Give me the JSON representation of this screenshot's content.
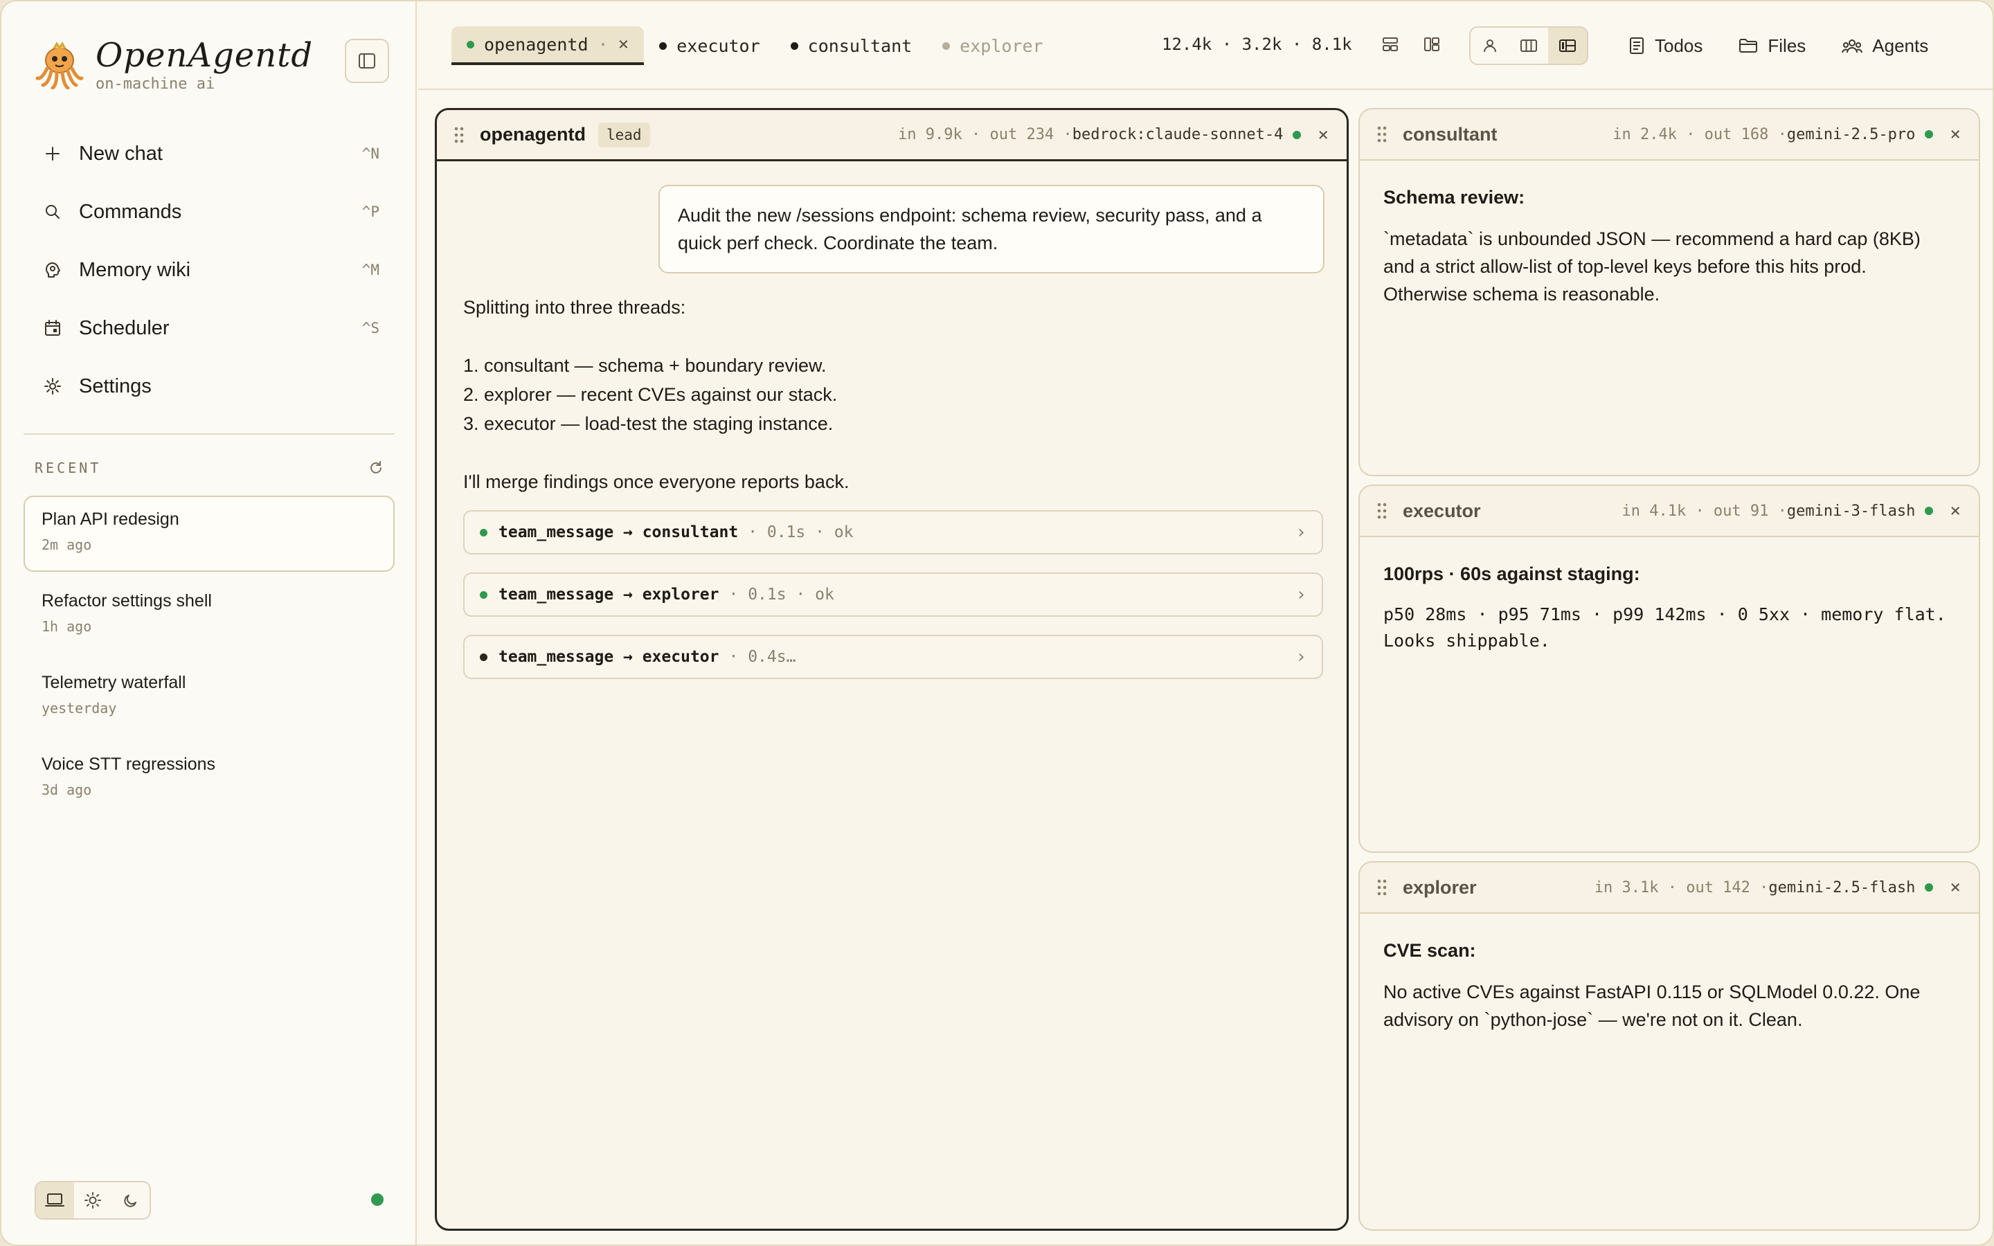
{
  "sidebar": {
    "brand": {
      "name": "OpenAgentd",
      "tagline": "on-machine ai"
    },
    "nav": [
      {
        "label": "New chat",
        "shortcut": "^N",
        "icon": "plus-icon"
      },
      {
        "label": "Commands",
        "shortcut": "^P",
        "icon": "search-icon"
      },
      {
        "label": "Memory wiki",
        "shortcut": "^M",
        "icon": "brain-icon"
      },
      {
        "label": "Scheduler",
        "shortcut": "^S",
        "icon": "calendar-icon"
      },
      {
        "label": "Settings",
        "shortcut": "",
        "icon": "gear-icon"
      }
    ],
    "recent_title": "RECENT",
    "recent": [
      {
        "name": "Plan API redesign",
        "time": "2m ago"
      },
      {
        "name": "Refactor settings shell",
        "time": "1h ago"
      },
      {
        "name": "Telemetry waterfall",
        "time": "yesterday"
      },
      {
        "name": "Voice STT regressions",
        "time": "3d ago"
      }
    ]
  },
  "topbar": {
    "tabs": [
      {
        "label": "openagentd",
        "sep": "·",
        "close": "×"
      },
      {
        "label": "executor"
      },
      {
        "label": "consultant"
      },
      {
        "label": "explorer"
      }
    ],
    "counts": "12.4k · 3.2k · 8.1k",
    "actions": [
      "Todos",
      "Files",
      "Agents"
    ]
  },
  "lead_pane": {
    "title": "openagentd",
    "badge": "lead",
    "meta": "in 9.9k · out 234 · ",
    "model": "bedrock:claude-sonnet-4",
    "close": "×",
    "user_message": "Audit the new /sessions endpoint: schema review, security pass, and a quick perf check. Coordinate the team.",
    "assistant": {
      "intro": "Splitting into three threads:",
      "steps": [
        "1. consultant — schema + boundary review.",
        "2. explorer — recent CVEs against our stack.",
        "3. executor — load-test the staging instance."
      ],
      "outro": "I'll merge findings once everyone reports back."
    },
    "tools": [
      {
        "name": "team_message → consultant",
        "meta": "· 0.1s · ok",
        "status": "ok",
        "chevron": "›"
      },
      {
        "name": "team_message → explorer",
        "meta": "· 0.1s · ok",
        "status": "ok",
        "chevron": "›"
      },
      {
        "name": "team_message → executor",
        "meta": "· 0.4s…",
        "status": "running",
        "chevron": "›"
      }
    ]
  },
  "side_panes": [
    {
      "title": "consultant",
      "meta": "in 2.4k · out 168 · ",
      "model": "gemini-2.5-pro",
      "close": "×",
      "heading": "Schema review:",
      "body": "`metadata` is unbounded JSON — recommend a hard cap (8KB) and a strict allow-list of top-level keys before this hits prod. Otherwise schema is reasonable."
    },
    {
      "title": "executor",
      "meta": "in 4.1k · out 91 · ",
      "model": "gemini-3-flash",
      "close": "×",
      "heading": "100rps · 60s against staging:",
      "body": "p50 28ms · p95 71ms · p99 142ms · 0 5xx · memory flat. Looks shippable."
    },
    {
      "title": "explorer",
      "meta": "in 3.1k · out 142 · ",
      "model": "gemini-2.5-flash",
      "close": "×",
      "heading": "CVE scan:",
      "body": "No active CVEs against FastAPI 0.115 or SQLModel 0.0.22. One advisory on `python-jose` — we're not on it. Clean."
    }
  ],
  "colors": {
    "accent_green": "#2e9a4f",
    "background": "#fbf8f0",
    "border": "#dcd2b7",
    "ink": "#1f1b16"
  }
}
